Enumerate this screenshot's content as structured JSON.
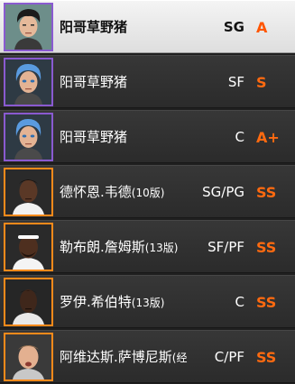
{
  "players": [
    {
      "name": "阳哥草野猪",
      "name_suffix": "",
      "position": "SG",
      "grade": "A",
      "avatar": "player-avatar-icon"
    },
    {
      "name": "阳哥草野猪",
      "name_suffix": "",
      "position": "SF",
      "grade": "S",
      "avatar": "player-avatar-icon"
    },
    {
      "name": "阳哥草野猪",
      "name_suffix": "",
      "position": "C",
      "grade": "A+",
      "avatar": "player-avatar-icon"
    },
    {
      "name": "德怀恩.韦德",
      "name_suffix": "(10版)",
      "position": "SG/PG",
      "grade": "SS",
      "avatar": "player-photo-icon"
    },
    {
      "name": "勒布朗.詹姆斯",
      "name_suffix": "(13版)",
      "position": "SF/PF",
      "grade": "SS",
      "avatar": "player-photo-icon"
    },
    {
      "name": "罗伊.希伯特",
      "name_suffix": "(13版)",
      "position": "C",
      "grade": "SS",
      "avatar": "player-photo-icon"
    },
    {
      "name": "阿维达斯.萨博尼斯",
      "name_suffix": "(经",
      "position": "C/PF",
      "grade": "SS",
      "avatar": "player-photo-icon"
    }
  ],
  "colors": {
    "grade": "#ff6a10",
    "border_custom": "#8a5ad0",
    "border_star": "#ff8a1a"
  }
}
